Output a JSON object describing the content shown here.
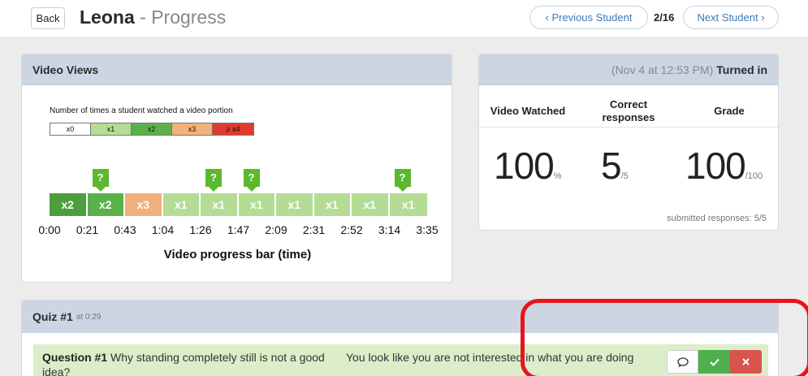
{
  "topbar": {
    "back_label": "Back",
    "student_name": "Leona",
    "title_separator": "-",
    "page_title": "Progress",
    "prev_label": "‹ Previous Student",
    "counter": "2/16",
    "next_label": "Next Student ›"
  },
  "video_views": {
    "header": "Video Views",
    "legend_title": "Number of times a student watched a video portion",
    "legend": [
      {
        "label": "x0",
        "color": "#ffffff"
      },
      {
        "label": "x1",
        "color": "#b5dc95"
      },
      {
        "label": "x2",
        "color": "#5ab14a"
      },
      {
        "label": "x3",
        "color": "#f2b279"
      },
      {
        "label": "≥ x4",
        "color": "#e03a2e"
      }
    ],
    "segments": [
      {
        "label": "x2",
        "color": "#4e9e3e"
      },
      {
        "label": "x2",
        "color": "#5ab14a"
      },
      {
        "label": "x3",
        "color": "#f0b07a"
      },
      {
        "label": "x1",
        "color": "#b5dc95"
      },
      {
        "label": "x1",
        "color": "#b5dc95"
      },
      {
        "label": "x1",
        "color": "#b5dc95"
      },
      {
        "label": "x1",
        "color": "#b5dc95"
      },
      {
        "label": "x1",
        "color": "#b5dc95"
      },
      {
        "label": "x1",
        "color": "#b5dc95"
      },
      {
        "label": "x1",
        "color": "#b5dc95"
      }
    ],
    "question_marker": "?",
    "question_markers_at_segment": [
      1,
      4,
      5,
      9
    ],
    "time_ticks": [
      "0:00",
      "0:21",
      "0:43",
      "1:04",
      "1:26",
      "1:47",
      "2:09",
      "2:31",
      "2:52",
      "3:14",
      "3:35"
    ],
    "axis_label": "Video progress bar (time)"
  },
  "summary": {
    "header_date": "(Nov 4 at 12:53 PM)",
    "header_status": "Turned in",
    "col_video": "Video Watched",
    "col_correct_line1": "Correct",
    "col_correct_line2": "responses",
    "col_grade": "Grade",
    "video_value": "100",
    "video_unit": "%",
    "correct_value": "5",
    "correct_unit": "/5",
    "grade_value": "100",
    "grade_unit": "/100",
    "submitted": "submitted responses: 5/5"
  },
  "quiz": {
    "title": "Quiz #1",
    "at_time": "at 0:29",
    "question_label": "Question #1",
    "question_text": "Why standing completely still is not a good idea?",
    "answer_text": "You look like you are not interested in what you are doing",
    "comment_icon": "speech-bubble-icon",
    "check_icon": "check-icon",
    "x_icon": "close-icon"
  },
  "colors": {
    "highlight_box": "#e8141d"
  }
}
